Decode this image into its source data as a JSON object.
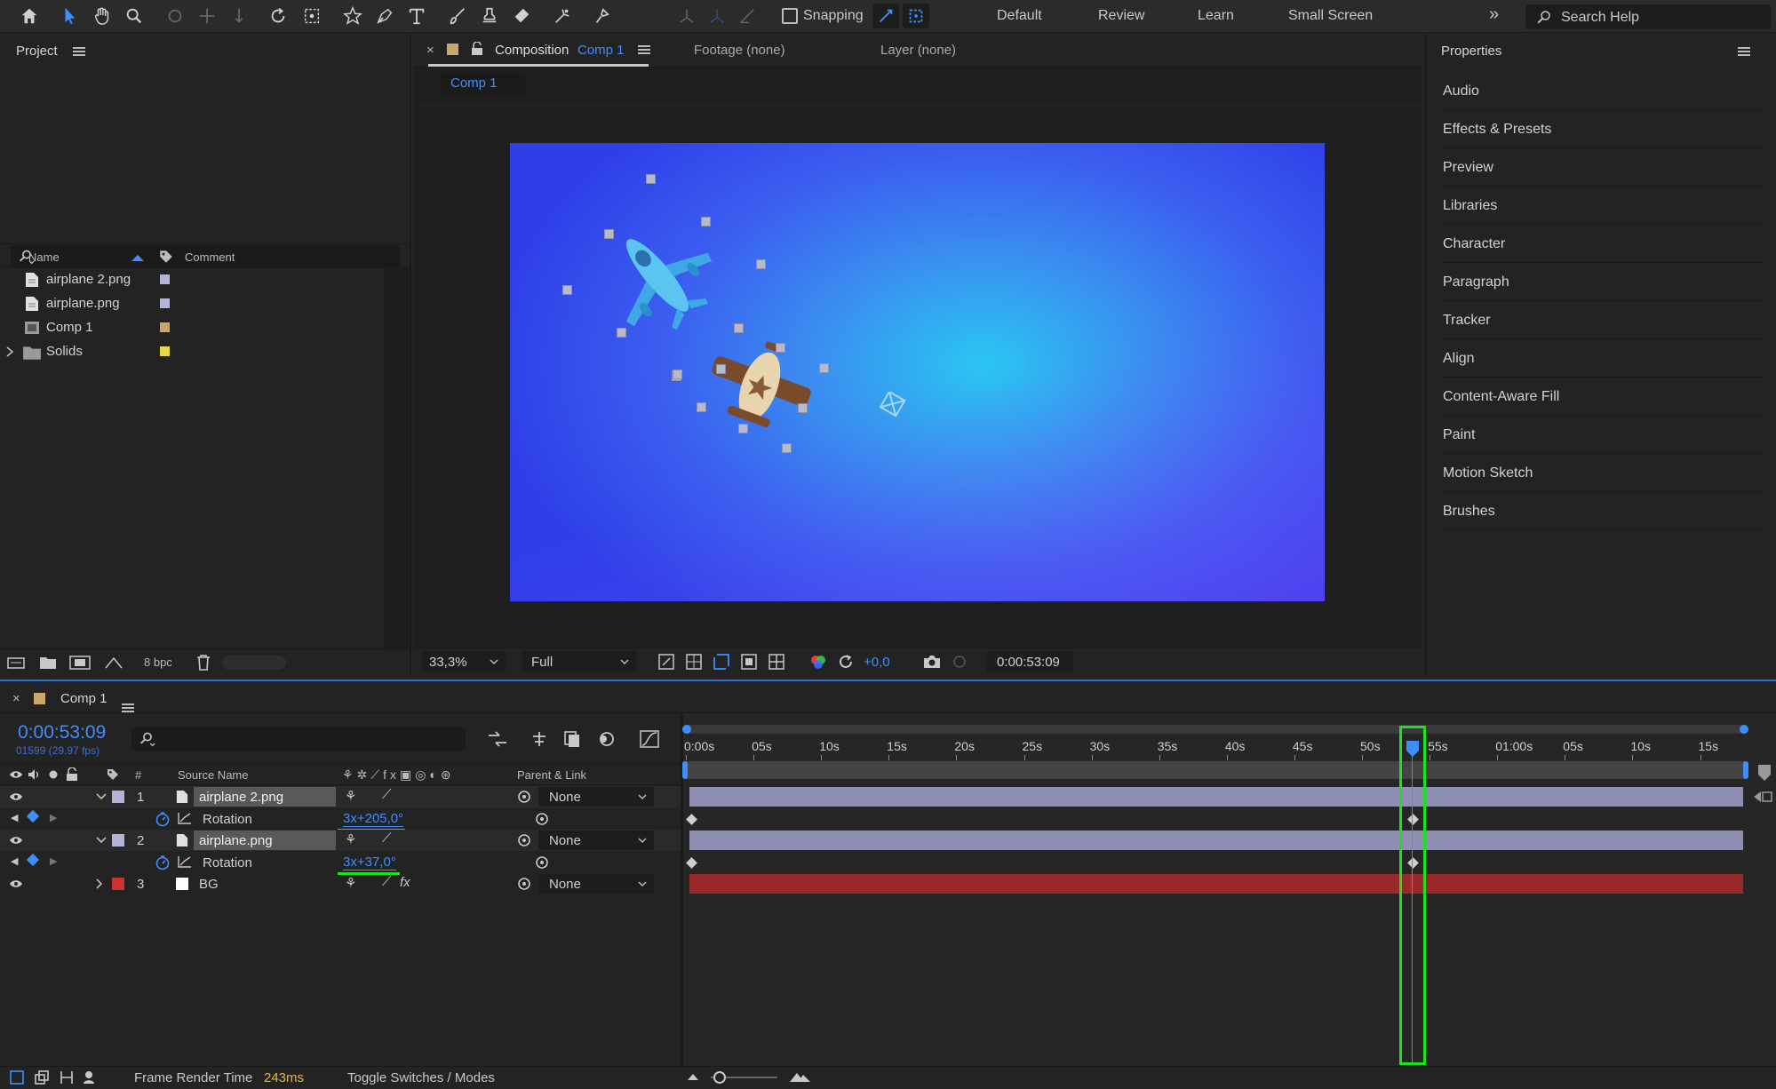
{
  "toolbar": {
    "snapping_label": "Snapping",
    "workspaces": [
      "Default",
      "Review",
      "Learn",
      "Small Screen"
    ],
    "search_placeholder": "Search Help"
  },
  "project": {
    "title": "Project",
    "col_name": "Name",
    "col_comment": "Comment",
    "items": [
      {
        "name": "airplane 2.png",
        "type": "file",
        "label_color": "#b4b4d8"
      },
      {
        "name": "airplane.png",
        "type": "file",
        "label_color": "#b4b4d8"
      },
      {
        "name": "Comp 1",
        "type": "comp",
        "label_color": "#c9a66b"
      },
      {
        "name": "Solids",
        "type": "folder",
        "label_color": "#e8d94b"
      }
    ],
    "bpc": "8 bpc"
  },
  "viewer": {
    "tab_close": "×",
    "tab_composition": "Composition",
    "tab_comp_name": "Comp 1",
    "tab_footage": "Footage (none)",
    "tab_layer": "Layer (none)",
    "breadcrumb": "Comp 1",
    "zoom": "33,3%",
    "resolution": "Full",
    "exposure": "+0,0",
    "timecode": "0:00:53:09"
  },
  "properties": {
    "title": "Properties",
    "items": [
      "Audio",
      "Effects & Presets",
      "Preview",
      "Libraries",
      "Character",
      "Paragraph",
      "Tracker",
      "Align",
      "Content-Aware Fill",
      "Paint",
      "Motion Sketch",
      "Brushes"
    ]
  },
  "timeline": {
    "comp_name": "Comp 1",
    "timecode": "0:00:53:09",
    "frame_info": "01599 (29.97 fps)",
    "col_number": "#",
    "col_source": "Source Name",
    "col_parent": "Parent & Link",
    "ruler": [
      "0:00s",
      "05s",
      "10s",
      "15s",
      "20s",
      "25s",
      "30s",
      "35s",
      "40s",
      "45s",
      "50s",
      "55s",
      "01:00s",
      "05s",
      "10s",
      "15s"
    ],
    "layers": [
      {
        "num": "1",
        "name": "airplane 2.png",
        "label_color": "#b4b4d8",
        "parent": "None",
        "prop": "Rotation",
        "value": "3x+205,0°"
      },
      {
        "num": "2",
        "name": "airplane.png",
        "label_color": "#b4b4d8",
        "parent": "None",
        "prop": "Rotation",
        "value": "3x+37,0°"
      },
      {
        "num": "3",
        "name": "BG",
        "label_color": "#cc3333",
        "parent": "None"
      }
    ],
    "frame_render_label": "Frame Render Time",
    "frame_render_value": "243ms",
    "toggle_label": "Toggle Switches / Modes"
  }
}
